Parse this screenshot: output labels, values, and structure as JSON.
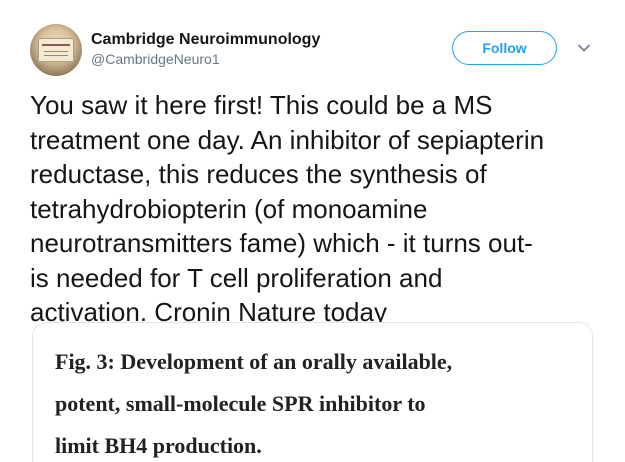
{
  "author": {
    "display_name": "Cambridge Neuroimmunology",
    "handle": "@CambridgeNeuro1"
  },
  "actions": {
    "follow_label": "Follow",
    "menu_icon": "chevron-down-icon"
  },
  "tweet": {
    "lines": [
      "You saw it here first! This could be a MS",
      "treatment one day. An inhibitor of sepiapterin",
      "reductase, this reduces the synthesis of",
      "tetrahydrobiopterin (of monoamine",
      "neurotransmitters fame) which - it turns out-",
      "is needed for T cell proliferation and",
      "activation. Cronin Nature today"
    ]
  },
  "card": {
    "title_lines": [
      "Fig. 3: Development of an orally available,",
      "potent, small-molecule SPR inhibitor to",
      "limit BH4 production."
    ]
  },
  "colors": {
    "accent": "#1da1f2",
    "text": "#14171a",
    "muted": "#657786",
    "border": "#e1e8ed"
  }
}
